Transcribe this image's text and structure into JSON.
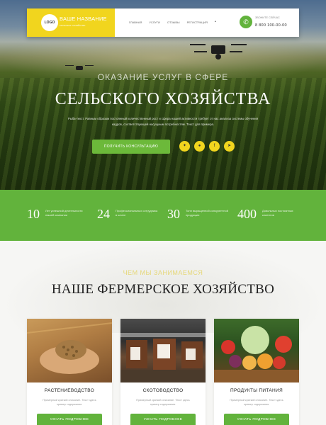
{
  "nav": {
    "logo": "LOGO",
    "brand_title": "ВАШЕ НАЗВАНИЕ",
    "brand_sub": "сельское хозяйство",
    "menu": [
      "ГЛАВНАЯ",
      "УСЛУГИ",
      "ОТЗЫВЫ",
      "РЕГИСТРАЦИЯ"
    ],
    "menu_dot": "•",
    "call_label": "ЗВОНИТЕ СЕЙЧАС",
    "phone": "8 800 100-00-00",
    "phone_icon": "phone-icon"
  },
  "hero": {
    "pre_title": "ОКАЗАНИЕ УСЛУГ В СФЕРЕ",
    "title": "СЕЛЬСКОГО ХОЗЯЙСТВА",
    "text": "Рыба-текст. Равным образом постоянный количественный рост и сфера нашей активности требует от нас анализа системы обучения кадров, соответствующей насущным потребностям. Текст для примера.",
    "cta": "ПОЛУЧИТЬ КОНСУЛЬТАЦИЮ",
    "socials": [
      "vk-icon",
      "odnoklassniki-icon",
      "facebook-icon",
      "telegram-icon"
    ],
    "social_glyphs": [
      "✦",
      "●",
      "f",
      "➤"
    ]
  },
  "stats": [
    {
      "num": "10",
      "label": "Лет успешной деятельности нашей компании"
    },
    {
      "num": "24",
      "label": "Профессиональных сотрудника в штате"
    },
    {
      "num": "30",
      "label": "Тонн выращенной конкурентной продукции"
    },
    {
      "num": "400",
      "label": "Довольных постоянных клиентов"
    }
  ],
  "farm": {
    "pre_title": "ЧЕМ МЫ ЗАНИМАЕМСЯ",
    "title": "НАШЕ ФЕРМЕРСКОЕ ХОЗЯЙСТВО",
    "cards": [
      {
        "title": "РАСТЕНИЕВОДСТВО",
        "text": "Примерный краткий описание. Текст здесь пример содержания.",
        "button": "УЗНАТЬ ПОДРОБНЕЕ"
      },
      {
        "title": "СКОТОВОДСТВО",
        "text": "Примерный краткий описание. Текст здесь пример содержания.",
        "button": "УЗНАТЬ ПОДРОБНЕЕ"
      },
      {
        "title": "ПРОДУКТЫ ПИТАНИЯ",
        "text": "Примерный краткий описание. Текст здесь пример содержания.",
        "button": "УЗНАТЬ ПОДРОБНЕЕ"
      }
    ]
  },
  "colors": {
    "accent_green": "#62b33c",
    "accent_yellow": "#f1d51e"
  }
}
